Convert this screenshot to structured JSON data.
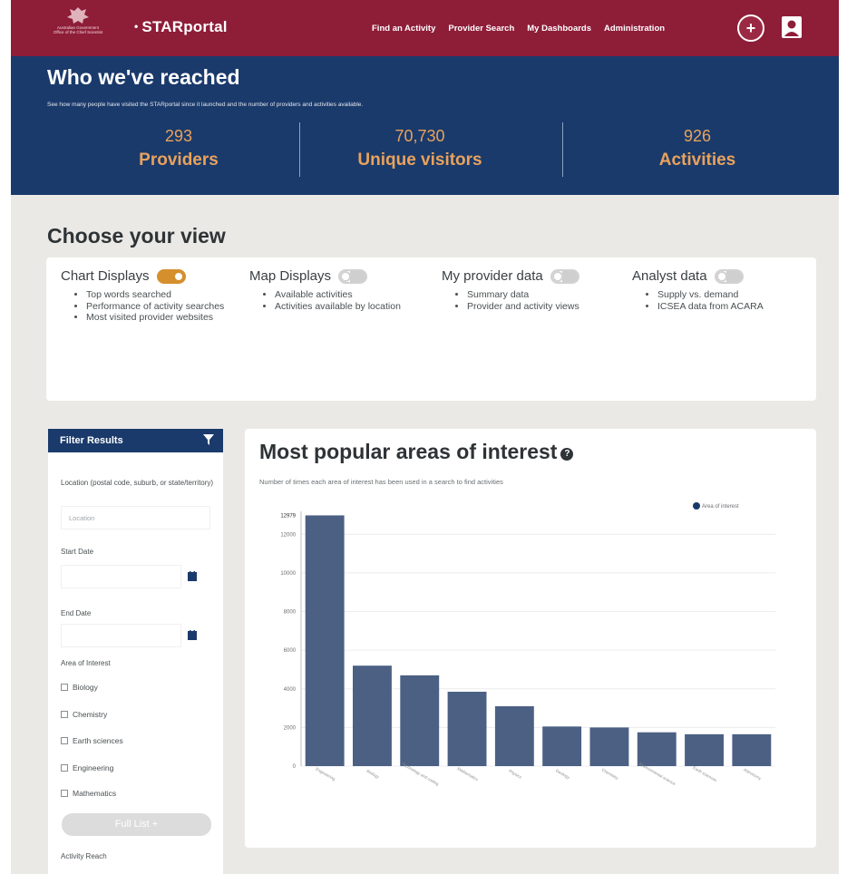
{
  "header": {
    "crest_text": [
      "Australian Government",
      "Office of the Chief Scientist"
    ],
    "brand": "STARportal",
    "nav_items": [
      "Find an Activity",
      "Provider Search",
      "My Dashboards",
      "Administration"
    ]
  },
  "stats": {
    "title": "Who we've reached",
    "subtitle": "See how many people have visited the STARportal since it launched and the number of providers and activities available.",
    "items": [
      {
        "value": "293",
        "label": "Providers"
      },
      {
        "value": "70,730",
        "label": "Unique visitors"
      },
      {
        "value": "926",
        "label": "Activities"
      }
    ]
  },
  "views": {
    "title": "Choose your view",
    "items": [
      {
        "label": "Chart Displays",
        "on": true,
        "bullets": [
          "Top words searched",
          "Performance of activity searches",
          "Most visited provider websites"
        ]
      },
      {
        "label": "Map Displays",
        "on": false,
        "bullets": [
          "Available activities",
          "Activities available by location"
        ]
      },
      {
        "label": "My provider data",
        "on": false,
        "bullets": [
          "Summary data",
          "Provider and activity views"
        ]
      },
      {
        "label": "Analyst data",
        "on": false,
        "bullets": [
          "Supply vs. demand",
          "ICSEA data from ACARA"
        ]
      }
    ]
  },
  "filter": {
    "title": "Filter Results",
    "location_label": "Location (postal code, suburb, or state/territory)",
    "location_placeholder": "Location",
    "start_label": "Start Date",
    "end_label": "End Date",
    "area_label": "Area of Interest",
    "areas": [
      "Biology",
      "Chemistry",
      "Earth sciences",
      "Engineering",
      "Mathematics"
    ],
    "full_list": "Full List +",
    "reach_label": "Activity Reach"
  },
  "chart_data": {
    "type": "bar",
    "title": "Most popular areas of interest",
    "subtitle": "Number of times each area of interest has been used in a search to find activities",
    "legend": "Area of interest",
    "legend_position": "top-right",
    "ylim": [
      0,
      13000
    ],
    "yticks": [
      0,
      2000,
      4000,
      6000,
      8000,
      10000,
      12000
    ],
    "max_label": "12979",
    "categories": [
      "Engineering",
      "Biology",
      "Technology and coding",
      "Mathematics",
      "Physics",
      "Geology",
      "Chemistry",
      "Environmental science",
      "Earth sciences",
      "Astronomy"
    ],
    "values": [
      12979,
      5200,
      4700,
      3850,
      3100,
      2050,
      2000,
      1750,
      1650,
      1650
    ],
    "color": "#4b6083"
  },
  "colors": {
    "nav_maroon": "#8e1d38",
    "banner_navy": "#1a3a6b",
    "stat_orange": "#e9a25c",
    "toggle_on": "#d68f2d"
  }
}
